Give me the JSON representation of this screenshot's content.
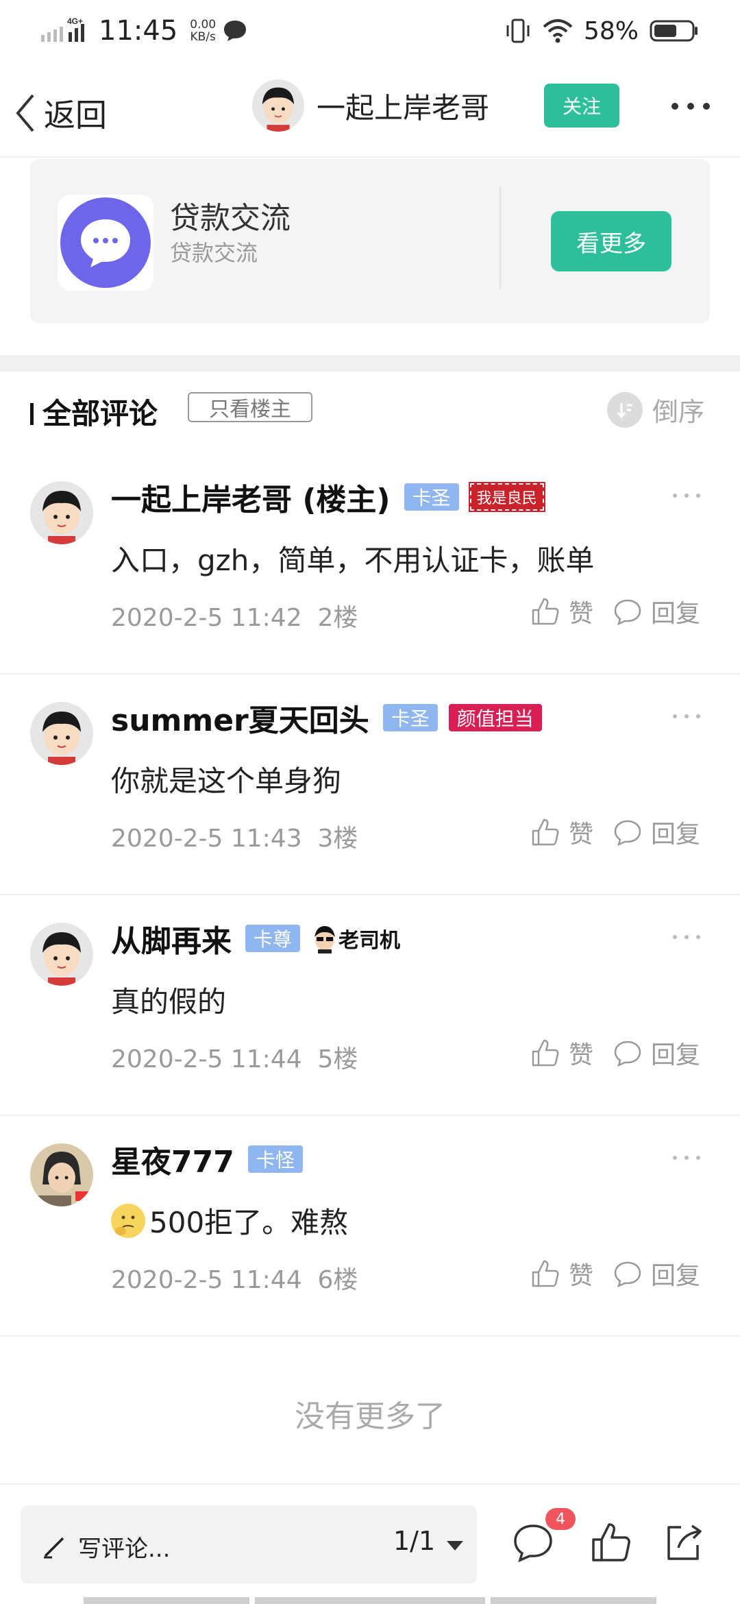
{
  "status_bar": {
    "network": "4G+",
    "time": "11:45",
    "speed_value": "0.00",
    "speed_unit": "KB/s",
    "battery_percent": "58%"
  },
  "nav": {
    "back_label": "返回",
    "username": "一起上岸老哥",
    "follow_label": "关注"
  },
  "group_card": {
    "title": "贷款交流",
    "subtitle": "贷款交流",
    "button_label": "看更多"
  },
  "comments_header": {
    "title": "全部评论",
    "only_op_label": "只看楼主",
    "sort_label": "倒序"
  },
  "comments": [
    {
      "name": "一起上岸老哥 (楼主)",
      "level": "卡圣",
      "badge": "我是良民",
      "badge_type": "stamp",
      "text": "入口，gzh，简单，不用认证卡，账单",
      "emoji": "",
      "time": "2020-2-5 11:42",
      "floor": "2楼",
      "like_label": "赞",
      "reply_label": "回复"
    },
    {
      "name": "summer夏天回头",
      "level": "卡圣",
      "badge": "颜值担当",
      "badge_type": "red",
      "text": "你就是这个单身狗",
      "emoji": "",
      "time": "2020-2-5 11:43",
      "floor": "3楼",
      "like_label": "赞",
      "reply_label": "回复"
    },
    {
      "name": "从脚再来",
      "level": "卡尊",
      "badge": "老司机",
      "badge_type": "driver",
      "text": "真的假的",
      "emoji": "",
      "time": "2020-2-5 11:44",
      "floor": "5楼",
      "like_label": "赞",
      "reply_label": "回复"
    },
    {
      "name": "星夜777",
      "level": "卡怪",
      "badge": "",
      "badge_type": "none",
      "text": "500拒了。难熬",
      "emoji": "thinking-face",
      "time": "2020-2-5 11:44",
      "floor": "6楼",
      "like_label": "赞",
      "reply_label": "回复"
    }
  ],
  "no_more_text": "没有更多了",
  "bottom_bar": {
    "write_placeholder": "写评论...",
    "page_indicator": "1/1",
    "comment_badge": "4"
  },
  "colors": {
    "accent_green": "#2dbf9a",
    "level_blue": "#8fb6ee",
    "badge_red": "#d81e52",
    "group_icon_purple": "#6d66ea",
    "notify_red": "#f0545d"
  },
  "icons": [
    "signal-icon",
    "chat-bubble-icon",
    "vibrate-icon",
    "wifi-icon",
    "battery-icon",
    "back-chevron-icon",
    "more-icon",
    "sort-icon",
    "thumb-up-icon",
    "comment-icon",
    "pencil-icon",
    "share-icon"
  ]
}
